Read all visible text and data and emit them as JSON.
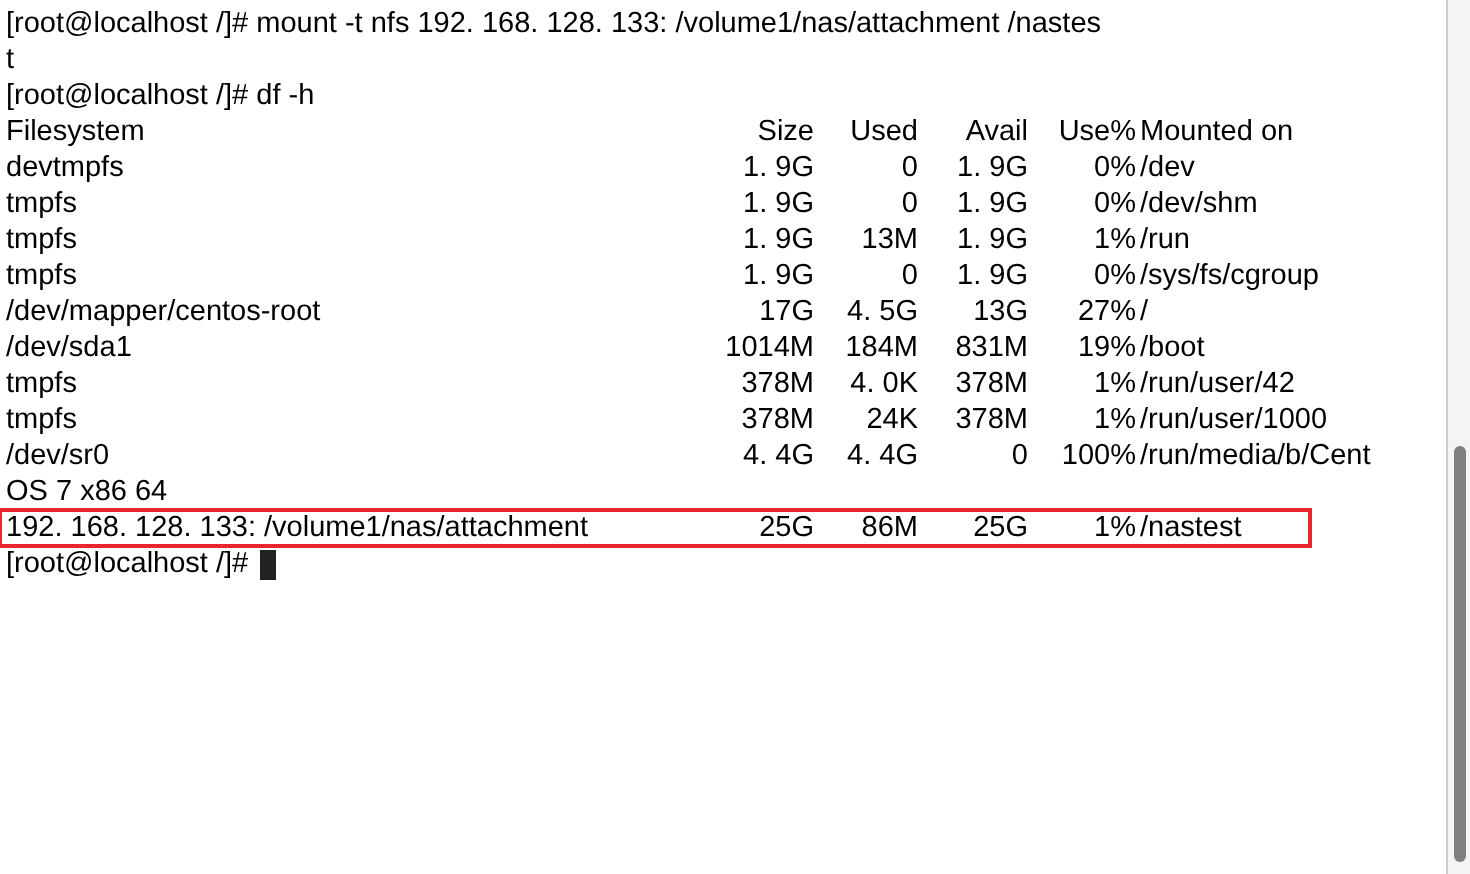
{
  "terminal": {
    "lines": [
      {
        "kind": "text",
        "text": "[root@localhost /]# mount -t nfs 192. 168. 128. 133: /volume1/nas/attachment /nastes"
      },
      {
        "kind": "text",
        "text": "t"
      },
      {
        "kind": "text",
        "text": "[root@localhost /]# df -h"
      },
      {
        "kind": "header",
        "cells": [
          "Filesystem",
          "Size",
          "Used",
          "Avail",
          "Use%",
          "Mounted on"
        ]
      },
      {
        "kind": "row",
        "highlighted": false,
        "cells": [
          "devtmpfs",
          "1. 9G",
          "0",
          "1. 9G",
          "0%",
          "/dev"
        ]
      },
      {
        "kind": "row",
        "highlighted": false,
        "cells": [
          "tmpfs",
          "1. 9G",
          "0",
          "1. 9G",
          "0%",
          "/dev/shm"
        ]
      },
      {
        "kind": "row",
        "highlighted": false,
        "cells": [
          "tmpfs",
          "1. 9G",
          "13M",
          "1. 9G",
          "1%",
          "/run"
        ]
      },
      {
        "kind": "row",
        "highlighted": false,
        "cells": [
          "tmpfs",
          "1. 9G",
          "0",
          "1. 9G",
          "0%",
          "/sys/fs/cgroup"
        ]
      },
      {
        "kind": "row",
        "highlighted": false,
        "cells": [
          "/dev/mapper/centos-root",
          "17G",
          "4. 5G",
          "13G",
          "27%",
          "/"
        ]
      },
      {
        "kind": "row",
        "highlighted": false,
        "cells": [
          "/dev/sda1",
          "1014M",
          "184M",
          "831M",
          "19%",
          "/boot"
        ]
      },
      {
        "kind": "row",
        "highlighted": false,
        "cells": [
          "tmpfs",
          "378M",
          "4. 0K",
          "378M",
          "1%",
          "/run/user/42"
        ]
      },
      {
        "kind": "row",
        "highlighted": false,
        "cells": [
          "tmpfs",
          "378M",
          "24K",
          "378M",
          "1%",
          "/run/user/1000"
        ]
      },
      {
        "kind": "row",
        "highlighted": false,
        "cells": [
          "/dev/sr0",
          "4. 4G",
          "4. 4G",
          "0",
          "100%",
          "/run/media/b/Cent"
        ]
      },
      {
        "kind": "text",
        "text": "OS 7 x86 64"
      },
      {
        "kind": "row",
        "highlighted": true,
        "cells": [
          "192. 168. 128. 133: /volume1/nas/attachment",
          "25G",
          "86M",
          "25G",
          "1%",
          "/nastest"
        ]
      },
      {
        "kind": "prompt",
        "text": "[root@localhost /]#"
      }
    ]
  }
}
